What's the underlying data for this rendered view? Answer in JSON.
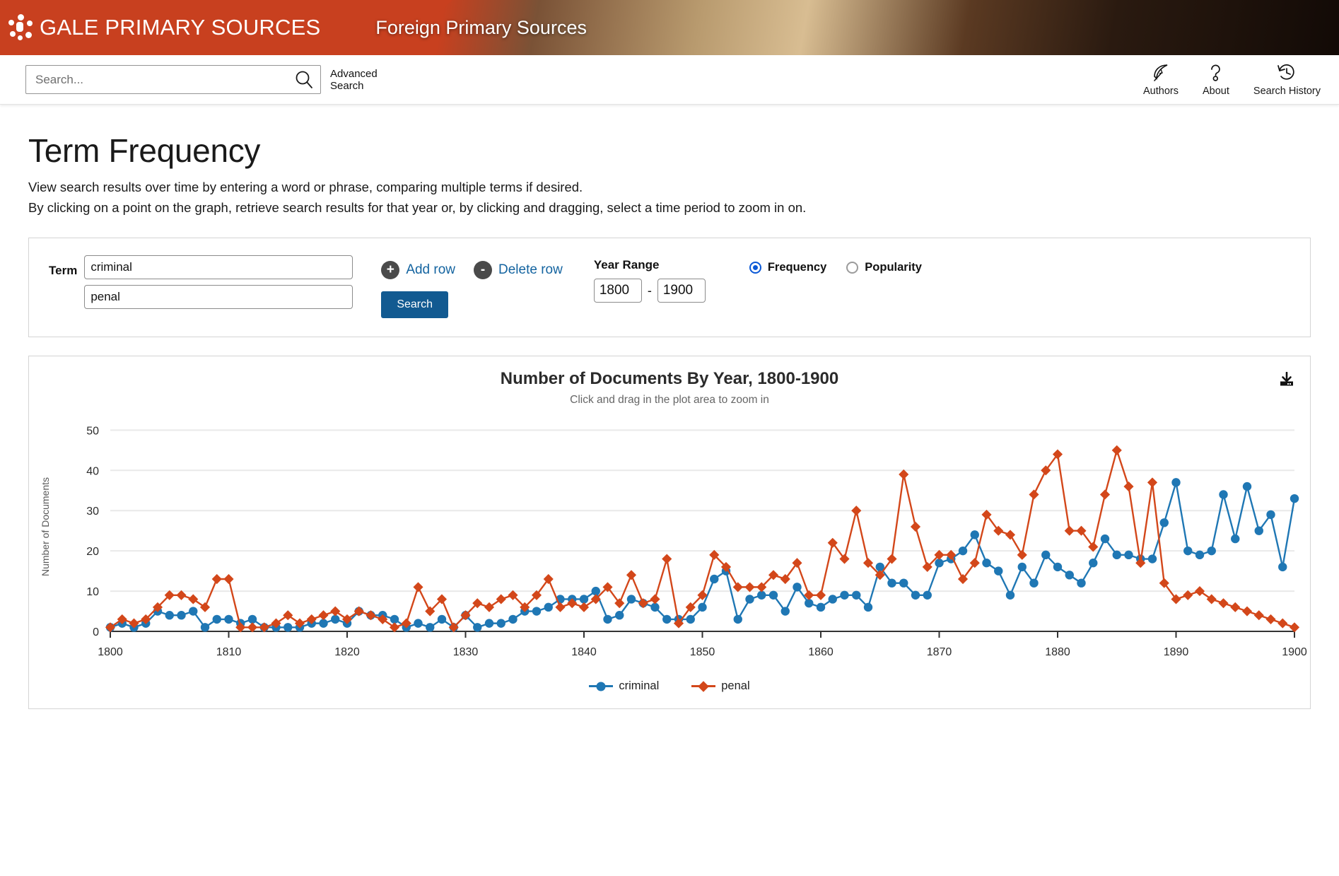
{
  "brand": {
    "logo_name": "gale-starburst-logo",
    "title": "GALE PRIMARY SOURCES",
    "product": "Foreign Primary Sources",
    "red": "#c8401f"
  },
  "search": {
    "placeholder": "Search...",
    "value": "",
    "advanced_line1": "Advanced",
    "advanced_line2": "Search"
  },
  "header_icons": [
    {
      "label": "Authors",
      "icon": "feather-icon"
    },
    {
      "label": "About",
      "icon": "question-mark-icon"
    },
    {
      "label": "Search History",
      "icon": "clock-history-icon"
    }
  ],
  "page": {
    "title": "Term Frequency",
    "lede_line1": "View search results over time by entering a word or phrase, comparing multiple terms if desired.",
    "lede_line2": "By clicking on a point on the graph, retrieve search results for that year or, by clicking and dragging, select a time period to zoom in on."
  },
  "form": {
    "term_label": "Term",
    "terms": [
      "criminal",
      "penal"
    ],
    "add_row": "Add row",
    "add_row_sign": "+",
    "delete_row": "Delete row",
    "delete_row_sign": "-",
    "search_button": "Search",
    "year_range_label": "Year Range",
    "year_from": "1800",
    "year_to": "1900",
    "dash": "-",
    "mode_options": [
      {
        "label": "Frequency",
        "selected": true
      },
      {
        "label": "Popularity",
        "selected": false
      }
    ],
    "accent_blue": "#1464a0",
    "button_blue": "#125a91",
    "radio_blue": "#0a58d6"
  },
  "chart_panel": {
    "download_icon": "download-icon"
  },
  "chart_data": {
    "type": "line",
    "title": "Number of Documents By Year, 1800-1900",
    "subtitle": "Click and drag in the plot area to zoom in",
    "xlabel": "",
    "ylabel": "Number of Documents",
    "xlim": [
      1800,
      1900
    ],
    "ylim": [
      0,
      52
    ],
    "yticks": [
      0,
      10,
      20,
      30,
      40,
      50
    ],
    "xticks": [
      1800,
      1810,
      1820,
      1830,
      1840,
      1850,
      1860,
      1870,
      1880,
      1890,
      1900
    ],
    "grid": "horizontal",
    "legend_position": "bottom-center",
    "colors": {
      "criminal": "#1f77b4",
      "penal": "#d3471a"
    },
    "markers": {
      "criminal": "circle",
      "penal": "diamond"
    },
    "x": [
      1800,
      1801,
      1802,
      1803,
      1804,
      1805,
      1806,
      1807,
      1808,
      1809,
      1810,
      1811,
      1812,
      1813,
      1814,
      1815,
      1816,
      1817,
      1818,
      1819,
      1820,
      1821,
      1822,
      1823,
      1824,
      1825,
      1826,
      1827,
      1828,
      1829,
      1830,
      1831,
      1832,
      1833,
      1834,
      1835,
      1836,
      1837,
      1838,
      1839,
      1840,
      1841,
      1842,
      1843,
      1844,
      1845,
      1846,
      1847,
      1848,
      1849,
      1850,
      1851,
      1852,
      1853,
      1854,
      1855,
      1856,
      1857,
      1858,
      1859,
      1860,
      1861,
      1862,
      1863,
      1864,
      1865,
      1866,
      1867,
      1868,
      1869,
      1870,
      1871,
      1872,
      1873,
      1874,
      1875,
      1876,
      1877,
      1878,
      1879,
      1880,
      1881,
      1882,
      1883,
      1884,
      1885,
      1886,
      1887,
      1888,
      1889,
      1890,
      1891,
      1892,
      1893,
      1894,
      1895,
      1896,
      1897,
      1898,
      1899,
      1900
    ],
    "series": [
      {
        "name": "criminal",
        "values": [
          1,
          2,
          1,
          2,
          5,
          4,
          4,
          5,
          1,
          3,
          3,
          2,
          3,
          1,
          1,
          1,
          1,
          2,
          2,
          3,
          2,
          5,
          4,
          4,
          3,
          1,
          2,
          1,
          3,
          1,
          4,
          1,
          2,
          2,
          3,
          5,
          5,
          6,
          8,
          8,
          8,
          10,
          3,
          4,
          8,
          7,
          6,
          3,
          3,
          3,
          6,
          13,
          15,
          3,
          8,
          9,
          9,
          5,
          11,
          7,
          6,
          8,
          9,
          9,
          6,
          16,
          12,
          12,
          9,
          9,
          17,
          18,
          20,
          24,
          17,
          15,
          9,
          16,
          12,
          19,
          16,
          14,
          12,
          17,
          23,
          19,
          19,
          18,
          18,
          27,
          37,
          20,
          19,
          20,
          34,
          23,
          36,
          25,
          29,
          16,
          33
        ]
      },
      {
        "name": "penal",
        "values": [
          1,
          3,
          2,
          3,
          6,
          9,
          9,
          8,
          6,
          13,
          13,
          1,
          1,
          1,
          2,
          4,
          2,
          3,
          4,
          5,
          3,
          5,
          4,
          3,
          1,
          2,
          11,
          5,
          8,
          1,
          4,
          7,
          6,
          8,
          9,
          6,
          9,
          13,
          6,
          7,
          6,
          8,
          11,
          7,
          14,
          7,
          8,
          18,
          2,
          6,
          9,
          19,
          16,
          11,
          11,
          11,
          14,
          13,
          17,
          9,
          9,
          22,
          18,
          30,
          17,
          14,
          18,
          39,
          26,
          16,
          19,
          19,
          13,
          17,
          29,
          25,
          24,
          19,
          34,
          40,
          44,
          25,
          25,
          21,
          34,
          45,
          36,
          17,
          37,
          12,
          8,
          9,
          10,
          8,
          7,
          6,
          5,
          4,
          3,
          2,
          1
        ]
      }
    ]
  },
  "legend": [
    {
      "label": "criminal",
      "color": "#1f77b4",
      "marker": "circle"
    },
    {
      "label": "penal",
      "color": "#d3471a",
      "marker": "diamond"
    }
  ]
}
